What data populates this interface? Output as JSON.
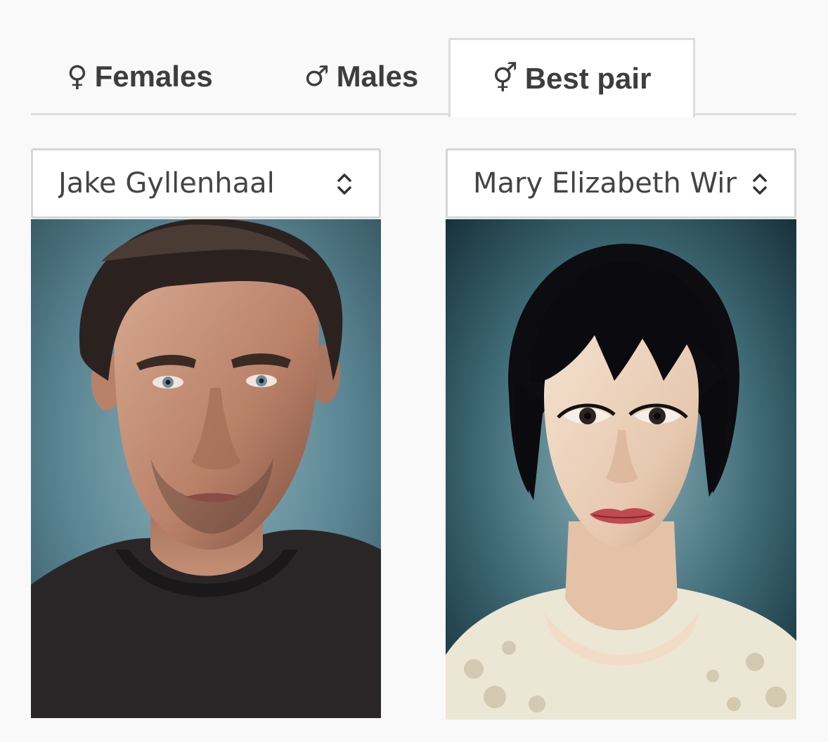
{
  "tabs": [
    {
      "label": "Females",
      "icon": "female-symbol-icon",
      "glyph": "♀",
      "active": false
    },
    {
      "label": "Males",
      "icon": "male-symbol-icon",
      "glyph": "♂",
      "active": false
    },
    {
      "label": "Best pair",
      "icon": "male-female-symbol-icon",
      "glyph": "⚥",
      "active": true
    }
  ],
  "left_select": {
    "value": "Jake Gyllenhaal",
    "icon": "up-down-chevron-icon"
  },
  "right_select": {
    "value": "Mary Elizabeth Winstead",
    "icon": "up-down-chevron-icon"
  },
  "photos": {
    "left": {
      "subject": "man-portrait",
      "background_color": "#4d7a88"
    },
    "right": {
      "subject": "woman-portrait",
      "background_color": "#2f5a66"
    }
  },
  "colors": {
    "page_background": "#f9f9f9",
    "tab_text": "#3d3d3d",
    "border": "#dddddd",
    "select_text": "#444444"
  }
}
